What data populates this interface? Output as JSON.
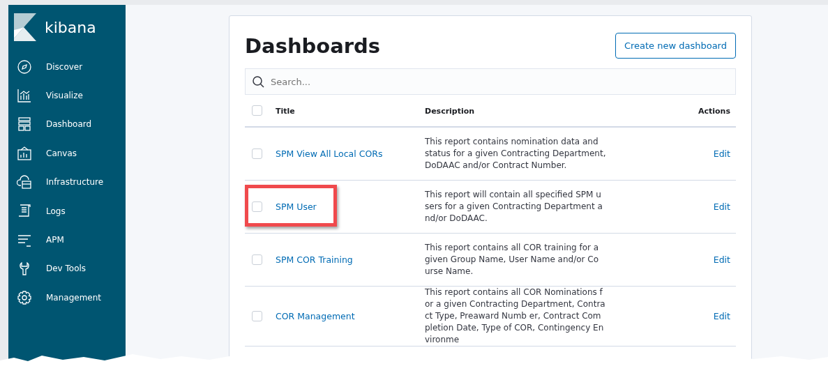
{
  "sidebar": {
    "brand": "kibana",
    "items": [
      {
        "label": "Discover",
        "kind": "compass"
      },
      {
        "label": "Visualize",
        "kind": "chart"
      },
      {
        "label": "Dashboard",
        "kind": "dashboard"
      },
      {
        "label": "Canvas",
        "kind": "canvas"
      },
      {
        "label": "Infrastructure",
        "kind": "cloud"
      },
      {
        "label": "Logs",
        "kind": "logs"
      },
      {
        "label": "APM",
        "kind": "apm"
      },
      {
        "label": "Dev Tools",
        "kind": "wrench"
      },
      {
        "label": "Management",
        "kind": "gear"
      }
    ]
  },
  "page": {
    "title": "Dashboards",
    "create_button": "Create new dashboard",
    "search": {
      "placeholder": "Search..."
    }
  },
  "table": {
    "columns": [
      "Title",
      "Description",
      "Actions"
    ],
    "header_checked": false,
    "rows": [
      {
        "title": "SPM View All Local CORs",
        "checked": false,
        "highlighted": false,
        "action": "Edit",
        "description": [
          "This report contains nomination data and",
          "status for a given Contracting Department,",
          "DoDAAC and/or Contract Number."
        ]
      },
      {
        "title": "SPM User",
        "checked": false,
        "highlighted": true,
        "action": "Edit",
        "description": [
          "This report will contain all specified SPM u",
          "sers for a given Contracting Department a",
          "nd/or DoDAAC."
        ]
      },
      {
        "title": "SPM COR Training",
        "checked": false,
        "highlighted": false,
        "action": "Edit",
        "description": [
          "This report contains all COR training for a",
          "given Group Name, User Name and/or Co",
          "urse Name."
        ]
      },
      {
        "title": "COR Management",
        "checked": false,
        "highlighted": false,
        "action": "Edit",
        "description": [
          "This report contains all COR Nominations f",
          "or a given Contracting Department, Contra",
          "ct Type, Preaward Numb er, Contract Com",
          "pletion Date, Type of COR, Contingency En",
          "vironme"
        ]
      }
    ]
  }
}
